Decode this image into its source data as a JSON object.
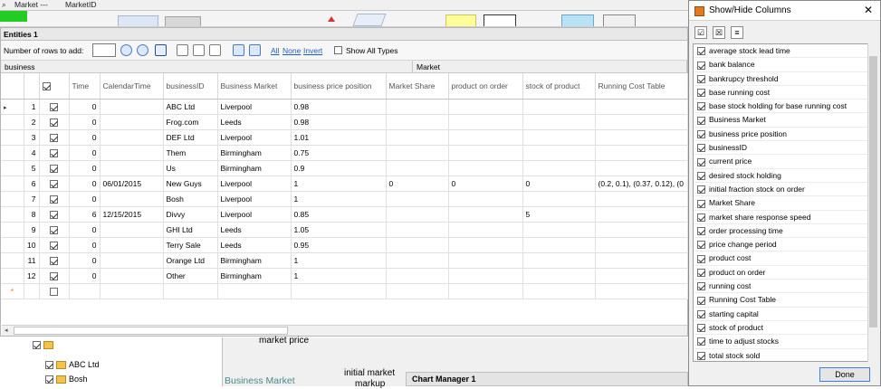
{
  "top_tabs": [
    "Market ---",
    "MarketID"
  ],
  "entities": {
    "title": "Entities 1",
    "toolbar": {
      "rows_label": "Number of rows to add:",
      "rows_value": "",
      "link_all": "All",
      "link_none": "None",
      "link_invert": "Invert",
      "show_all_types": "Show All Types"
    },
    "group_headers": [
      "business",
      "Market"
    ],
    "columns": [
      "",
      "Time",
      "CalendarTime",
      "businessID",
      "Business Market",
      "business price position",
      "Market Share",
      "product on order",
      "stock of product",
      "Running Cost Table"
    ],
    "rows": [
      {
        "n": "1",
        "time": "0",
        "cal": "",
        "id": "ABC Ltd",
        "market": "Liverpool",
        "price": "0.98",
        "share": "",
        "order": "",
        "stock": "",
        "cost": ""
      },
      {
        "n": "2",
        "time": "0",
        "cal": "",
        "id": "Frog.com",
        "market": "Leeds",
        "price": "0.98",
        "share": "",
        "order": "",
        "stock": "",
        "cost": ""
      },
      {
        "n": "3",
        "time": "0",
        "cal": "",
        "id": "DEF Ltd",
        "market": "Liverpool",
        "price": "1.01",
        "share": "",
        "order": "",
        "stock": "",
        "cost": ""
      },
      {
        "n": "4",
        "time": "0",
        "cal": "",
        "id": "Them",
        "market": "Birmingham",
        "price": "0.75",
        "share": "",
        "order": "",
        "stock": "",
        "cost": ""
      },
      {
        "n": "5",
        "time": "0",
        "cal": "",
        "id": "Us",
        "market": "Birmingham",
        "price": "0.9",
        "share": "",
        "order": "",
        "stock": "",
        "cost": ""
      },
      {
        "n": "6",
        "time": "0",
        "cal": "06/01/2015",
        "id": "New Guys",
        "market": "Liverpool",
        "price": "1",
        "share": "0",
        "order": "0",
        "stock": "0",
        "cost": "(0.2, 0.1), (0.37, 0.12), (0"
      },
      {
        "n": "7",
        "time": "0",
        "cal": "",
        "id": "Bosh",
        "market": "Liverpool",
        "price": "1",
        "share": "",
        "order": "",
        "stock": "",
        "cost": ""
      },
      {
        "n": "8",
        "time": "6",
        "cal": "12/15/2015",
        "id": "Divvy",
        "market": "Liverpool",
        "price": "0.85",
        "share": "",
        "order": "",
        "stock": "5",
        "cost": ""
      },
      {
        "n": "9",
        "time": "0",
        "cal": "",
        "id": "GHI Ltd",
        "market": "Leeds",
        "price": "1.05",
        "share": "",
        "order": "",
        "stock": "",
        "cost": ""
      },
      {
        "n": "10",
        "time": "0",
        "cal": "",
        "id": "Terry Sale",
        "market": "Leeds",
        "price": "0.95",
        "share": "",
        "order": "",
        "stock": "",
        "cost": ""
      },
      {
        "n": "11",
        "time": "0",
        "cal": "",
        "id": "Orange Ltd",
        "market": "Birmingham",
        "price": "1",
        "share": "",
        "order": "",
        "stock": "",
        "cost": ""
      },
      {
        "n": "12",
        "time": "0",
        "cal": "",
        "id": "Other",
        "market": "Birmingham",
        "price": "1",
        "share": "",
        "order": "",
        "stock": "",
        "cost": ""
      }
    ],
    "new_row_marker": "*"
  },
  "bottom": {
    "tree_items": [
      "",
      "ABC Ltd",
      "Bosh"
    ],
    "texts": {
      "market_price": "market price",
      "business_market": "Business Market",
      "initial_market": "initial market",
      "markup": "markup",
      "chart_manager": "Chart Manager 1"
    }
  },
  "popup": {
    "title": "Show/Hide Columns",
    "done": "Done",
    "items": [
      "average stock lead time",
      "bank balance",
      "bankrupcy threshold",
      "base running cost",
      "base stock holding for base running cost",
      "Business Market",
      "business price position",
      "businessID",
      "current price",
      "desired stock holding",
      "initial fraction stock on order",
      "Market Share",
      "market share response speed",
      "order processing time",
      "price change period",
      "product cost",
      "product on order",
      "running cost",
      "Running Cost Table",
      "starting capital",
      "stock of product",
      "time to adjust stocks",
      "total stock sold"
    ]
  },
  "colors": {
    "accent_green": "#22cc22",
    "link": "#1f5fbf",
    "note_yellow": "#ffff99"
  }
}
